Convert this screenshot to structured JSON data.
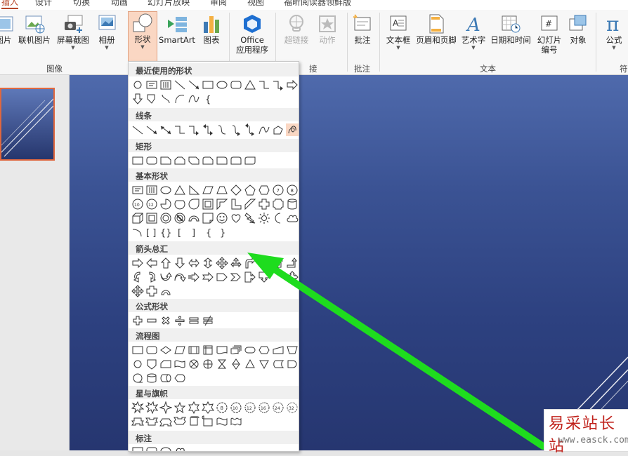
{
  "ribbon_tabs": [
    "插入",
    "设计",
    "切换",
    "动画",
    "幻灯片放映",
    "审阅",
    "视图",
    "福昕阅读器领鲜版"
  ],
  "ribbon": {
    "buttons": [
      "图片",
      "联机图片",
      "屏幕截图",
      "相册",
      "形状",
      "SmartArt",
      "图表",
      "Office\n应用程序",
      "超链接",
      "动作",
      "批注",
      "文本框",
      "页眉和页脚",
      "艺术字",
      "日期和时间",
      "幻灯片\n编号",
      "对象",
      "公式"
    ],
    "groups": [
      "图像",
      "接",
      "批注",
      "文本",
      "符"
    ]
  },
  "shapes_gallery": {
    "sections": [
      "最近使用的形状",
      "线条",
      "矩形",
      "基本形状",
      "箭头总汇",
      "公式形状",
      "流程图",
      "星与旗帜",
      "标注"
    ]
  },
  "watermark": {
    "title": "易采站长站",
    "url": "www.easck.com"
  },
  "colors": {
    "accent": "#b7472a",
    "arrow": "#1edc1e",
    "slide_top": "#4f6aac",
    "slide_bottom": "#263670"
  }
}
